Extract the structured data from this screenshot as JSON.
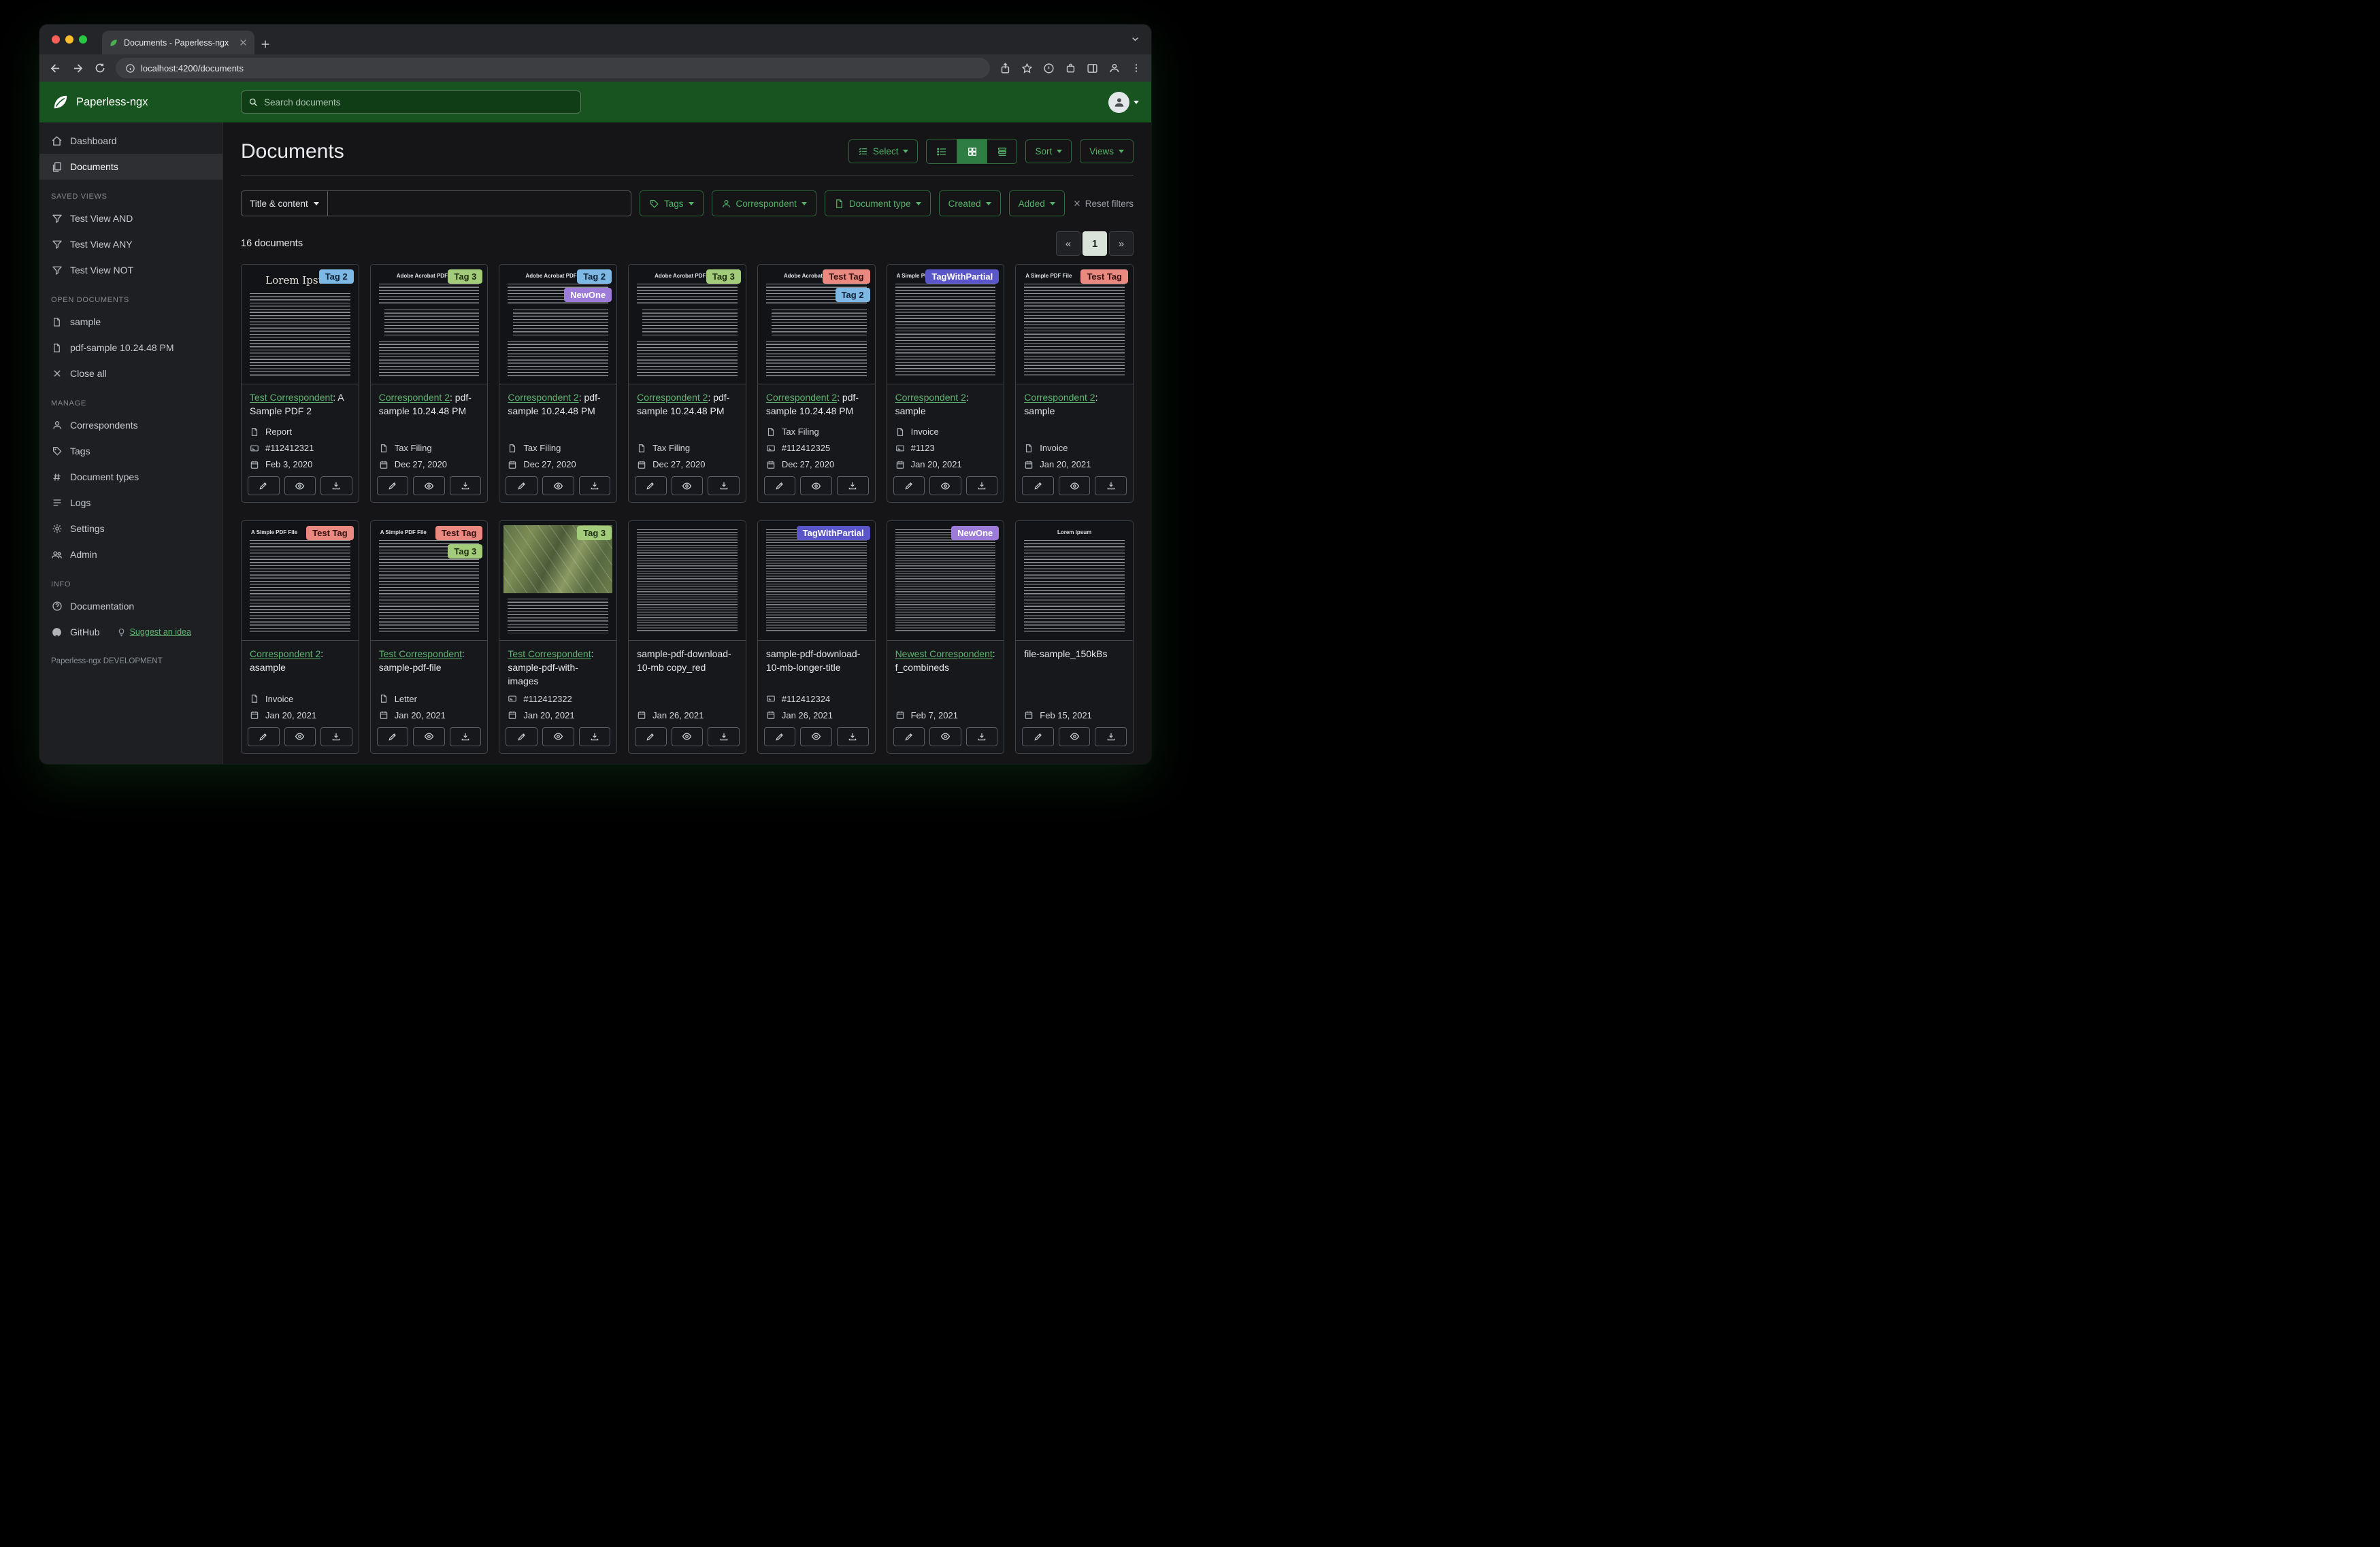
{
  "browser": {
    "tab_title": "Documents - Paperless-ngx",
    "url": "localhost:4200/documents"
  },
  "app_header": {
    "brand": "Paperless-ngx",
    "search_placeholder": "Search documents"
  },
  "sidebar": {
    "dashboard": "Dashboard",
    "documents": "Documents",
    "saved_views": {
      "title": "SAVED VIEWS",
      "items": [
        "Test View AND",
        "Test View ANY",
        "Test View NOT"
      ]
    },
    "open_documents": {
      "title": "OPEN DOCUMENTS",
      "items": [
        "sample",
        "pdf-sample 10.24.48 PM"
      ],
      "close_all": "Close all"
    },
    "manage": {
      "title": "MANAGE",
      "items": [
        "Correspondents",
        "Tags",
        "Document types",
        "Logs",
        "Settings",
        "Admin"
      ]
    },
    "info": {
      "title": "INFO",
      "items": [
        "Documentation",
        "GitHub"
      ],
      "suggest": "Suggest an idea"
    },
    "footer": "Paperless-ngx DEVELOPMENT"
  },
  "toolbar": {
    "heading": "Documents",
    "select": "Select",
    "sort": "Sort",
    "views": "Views"
  },
  "filters": {
    "title_dropdown": "Title & content",
    "tags": "Tags",
    "correspondent": "Correspondent",
    "document_type": "Document type",
    "created": "Created",
    "added": "Added",
    "reset": "Reset filters"
  },
  "documents": {
    "count": "16 documents",
    "pagination": {
      "prev": "«",
      "current": "1",
      "next": "»"
    },
    "tag_colors": {
      "Tag 2": {
        "bg": "#7eb8e4",
        "fg": "#0b2239"
      },
      "Tag 3": {
        "bg": "#a3cc7a",
        "fg": "#1d2b10"
      },
      "Test Tag": {
        "bg": "#e98980",
        "fg": "#331111"
      },
      "NewOne": {
        "bg": "#9d7bd8",
        "fg": "#ffffff"
      },
      "TagWithPartial": {
        "bg": "#5a55c9",
        "fg": "#ffffff"
      }
    },
    "cards": [
      {
        "tags": [
          "Tag 2"
        ],
        "thumb": "lorem",
        "thumb_heading": "Lorem Ipsum",
        "title_link": "Test Correspondent",
        "title_rest": ": A Sample PDF 2",
        "type": "Report",
        "asn": "#112412321",
        "date": "Feb 3, 2020"
      },
      {
        "tags": [
          "Tag 3"
        ],
        "thumb": "acrobat",
        "thumb_heading": "Adobe Acrobat PDF Files",
        "title_link": "Correspondent 2",
        "title_rest": ": pdf-sample 10.24.48 PM",
        "type": "Tax Filing",
        "date": "Dec 27, 2020"
      },
      {
        "tags": [
          "Tag 2",
          "NewOne"
        ],
        "thumb": "acrobat",
        "thumb_heading": "Adobe Acrobat PDF Files",
        "title_link": "Correspondent 2",
        "title_rest": ": pdf-sample 10.24.48 PM",
        "type": "Tax Filing",
        "date": "Dec 27, 2020"
      },
      {
        "tags": [
          "Tag 3"
        ],
        "thumb": "acrobat",
        "thumb_heading": "Adobe Acrobat PDF Files",
        "title_link": "Correspondent 2",
        "title_rest": ": pdf-sample 10.24.48 PM",
        "type": "Tax Filing",
        "date": "Dec 27, 2020"
      },
      {
        "tags": [
          "Test Tag",
          "Tag 2"
        ],
        "thumb": "acrobat",
        "thumb_heading": "Adobe Acrobat PDF Files",
        "title_link": "Correspondent 2",
        "title_rest": ": pdf-sample 10.24.48 PM",
        "type": "Tax Filing",
        "asn": "#112412325",
        "date": "Dec 27, 2020"
      },
      {
        "tags": [
          "TagWithPartial"
        ],
        "thumb": "simple",
        "thumb_heading": "A Simple PDF File",
        "title_link": "Correspondent 2",
        "title_rest": ": sample",
        "type": "Invoice",
        "asn": "#1123",
        "date": "Jan 20, 2021"
      },
      {
        "tags": [
          "Test Tag"
        ],
        "thumb": "simple",
        "thumb_heading": "A Simple PDF File",
        "title_link": "Correspondent 2",
        "title_rest": ": sample",
        "type": "Invoice",
        "date": "Jan 20, 2021"
      },
      {
        "tags": [
          "Test Tag"
        ],
        "thumb": "simple",
        "thumb_heading": "A Simple PDF File",
        "title_link": "Correspondent 2",
        "title_rest": ": asample",
        "type": "Invoice",
        "date": "Jan 20, 2021"
      },
      {
        "tags": [
          "Test Tag",
          "Tag 3"
        ],
        "thumb": "simple",
        "thumb_heading": "A Simple PDF File",
        "title_link": "Test Correspondent",
        "title_rest": ": sample-pdf-file",
        "type": "Letter",
        "date": "Jan 20, 2021"
      },
      {
        "tags": [
          "Tag 3"
        ],
        "thumb": "map",
        "thumb_heading": "",
        "title_link": "Test Correspondent",
        "title_rest": ": sample-pdf-with-images",
        "asn": "#112412322",
        "date": "Jan 20, 2021"
      },
      {
        "tags": [],
        "thumb": "dense",
        "thumb_heading": "",
        "title_plain": "sample-pdf-download-10-mb copy_red",
        "date": "Jan 26, 2021"
      },
      {
        "tags": [
          "TagWithPartial"
        ],
        "thumb": "dense",
        "thumb_heading": "",
        "title_plain": "sample-pdf-download-10-mb-longer-title",
        "asn": "#112412324",
        "date": "Jan 26, 2021"
      },
      {
        "tags": [
          "NewOne"
        ],
        "thumb": "dense",
        "thumb_heading": "",
        "title_link": "Newest Correspondent",
        "title_rest": ": f_combineds",
        "date": "Feb 7, 2021"
      },
      {
        "tags": [],
        "thumb": "lorem2",
        "thumb_heading": "Lorem ipsum",
        "title_plain": "file-sample_150kBs",
        "date": "Feb 15, 2021"
      }
    ]
  }
}
